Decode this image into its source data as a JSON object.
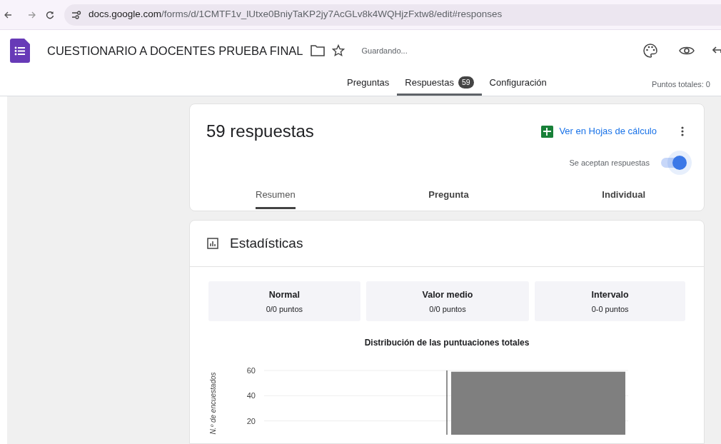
{
  "browser": {
    "url_host": "docs.google.com",
    "url_path": "/forms/d/1CMTF1v_lUtxe0BniyTaKP2jy7AcGLv8k4WQHjzFxtw8/edit#responses"
  },
  "form": {
    "title": "CUESTIONARIO A DOCENTES PRUEBA FINAL",
    "save_status": "Guardando..."
  },
  "tabs": [
    {
      "label": "Preguntas",
      "selected": false
    },
    {
      "label": "Respuestas",
      "badge": "59",
      "selected": true
    },
    {
      "label": "Configuración",
      "selected": false
    }
  ],
  "total_points": "Puntos totales: 0",
  "responses": {
    "count": "59 respuestas",
    "sheets_link": "Ver en Hojas de cálculo",
    "accepting_label": "Se aceptan respuestas",
    "accepting": {
      "on": true
    }
  },
  "view_tabs": [
    {
      "label": "Resumen",
      "selected": true
    },
    {
      "label": "Pregunta",
      "selected": false
    },
    {
      "label": "Individual",
      "selected": false
    }
  ],
  "stats": {
    "title": "Estadísticas",
    "cards": [
      {
        "label": "Normal",
        "value": "0/0 puntos"
      },
      {
        "label": "Valor medio",
        "value": "0/0 puntos"
      },
      {
        "label": "Intervalo",
        "value": "0-0 puntos"
      }
    ],
    "chart_data": {
      "type": "bar",
      "title": "Distribución de las puntuaciones totales",
      "ylabel": "N.º de encuestados",
      "values": [
        59
      ],
      "ylim": [
        0,
        60
      ],
      "yticks": [
        20,
        40,
        60
      ]
    }
  }
}
